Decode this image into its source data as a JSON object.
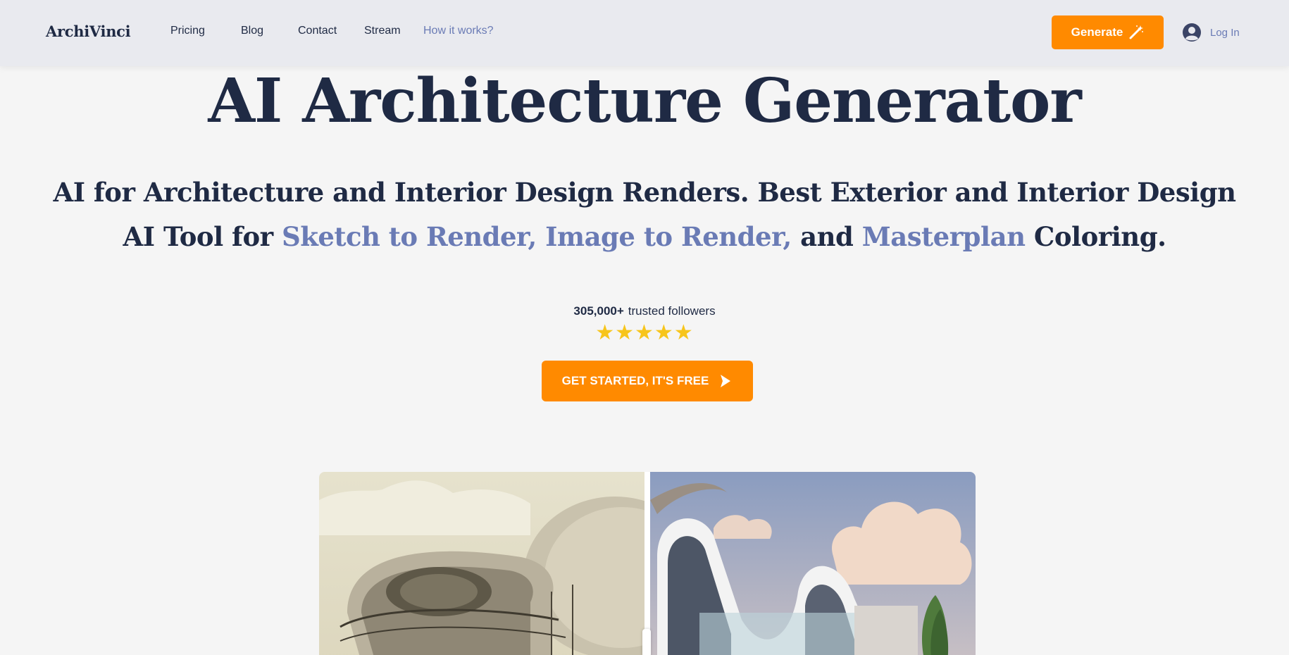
{
  "header": {
    "logo": "ArchiVinci",
    "nav": [
      {
        "label": "Pricing"
      },
      {
        "label": "Blog"
      },
      {
        "label": "Contact"
      },
      {
        "label": "Stream"
      },
      {
        "label": "How it works?"
      }
    ],
    "generate_label": "Generate",
    "login_label": "Log In"
  },
  "hero": {
    "title": "AI Architecture Generator",
    "subtitle_part1": "AI for Architecture and Interior Design Renders. Best Exterior and Interior Design AI Tool for ",
    "subtitle_hl1": "Sketch to Render, Image to Render,",
    "subtitle_part2": " and ",
    "subtitle_hl2": "Masterplan",
    "subtitle_part3": " Coloring.",
    "followers_count": "305,000+",
    "followers_label": "trusted followers",
    "stars": "★★★★★",
    "rating": 5,
    "cta_label": "GET STARTED, IT'S FREE"
  },
  "colors": {
    "accent": "#ff8a00",
    "link": "#6a7bb5",
    "text": "#1f2a44",
    "star": "#f7c51b",
    "background": "#f5f5f5"
  },
  "icons": {
    "generate": "magic-wand-icon",
    "login": "user-avatar-icon",
    "cta": "play-cursor-icon",
    "rating": "star-icon"
  }
}
